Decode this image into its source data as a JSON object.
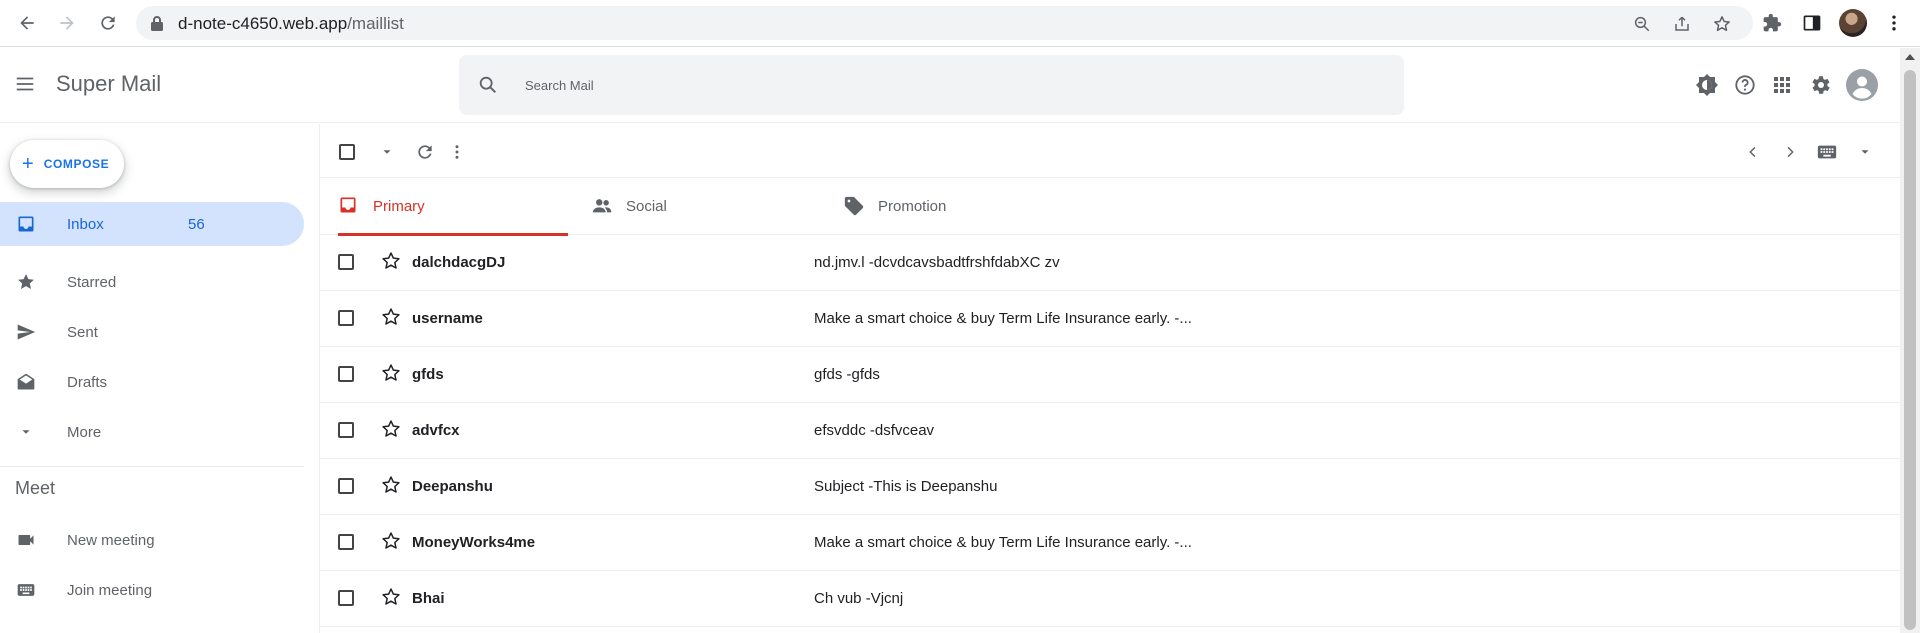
{
  "browser": {
    "url_host": "d-note-c4650.web.app",
    "url_path": "/maillist"
  },
  "app": {
    "title": "Super Mail",
    "search_placeholder": "Search Mail"
  },
  "sidebar": {
    "compose_label": "COMPOSE",
    "items": [
      {
        "label": "Inbox",
        "count": "56",
        "icon": "inbox-icon"
      },
      {
        "label": "Starred",
        "icon": "star-icon"
      },
      {
        "label": "Sent",
        "icon": "send-icon"
      },
      {
        "label": "Drafts",
        "icon": "drafts-icon"
      },
      {
        "label": "More",
        "icon": "chevron-down-icon"
      }
    ],
    "meet_title": "Meet",
    "meet_items": [
      {
        "label": "New meeting",
        "icon": "videocam-icon"
      },
      {
        "label": "Join meeting",
        "icon": "keyboard-icon"
      }
    ]
  },
  "tabs": [
    {
      "label": "Primary",
      "icon": "inbox-icon",
      "active": true
    },
    {
      "label": "Social",
      "icon": "people-icon"
    },
    {
      "label": "Promotion",
      "icon": "tag-icon"
    }
  ],
  "emails": [
    {
      "sender": "dalchdacgDJ",
      "subject": "nd.jmv.l -dcvdcavsbadtfrshfdabXC zv"
    },
    {
      "sender": "username",
      "subject": "Make a smart choice & buy Term Life Insurance early. -..."
    },
    {
      "sender": "gfds",
      "subject": "gfds -gfds"
    },
    {
      "sender": "advfcx",
      "subject": "efsvddc -dsfvceav"
    },
    {
      "sender": "Deepanshu",
      "subject": "Subject -This is Deepanshu"
    },
    {
      "sender": "MoneyWorks4me",
      "subject": "Make a smart choice & buy Term Life Insurance early. -..."
    },
    {
      "sender": "Bhai",
      "subject": "Ch vub -Vjcnj"
    }
  ],
  "colors": {
    "accent_red": "#d93025",
    "accent_blue": "#1967d2",
    "active_nav_bg": "#d3e3fd"
  }
}
